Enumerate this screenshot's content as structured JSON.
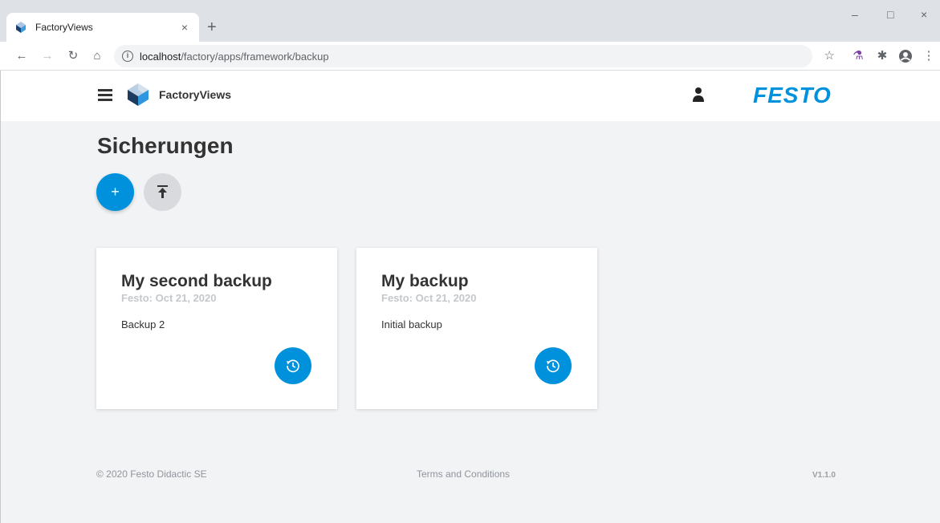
{
  "browser": {
    "tab_title": "FactoryViews",
    "tab_close": "×",
    "new_tab": "+",
    "url_host": "localhost",
    "url_path": "/factory/apps/framework/backup",
    "window_controls": [
      "–",
      "□",
      "×"
    ]
  },
  "header": {
    "app_name": "FactoryViews",
    "brand": "FESTO"
  },
  "main": {
    "title": "Sicherungen",
    "add_label": "+"
  },
  "cards": [
    {
      "title": "My second backup",
      "subtitle": "Festo: Oct 21, 2020",
      "description": "Backup 2"
    },
    {
      "title": "My backup",
      "subtitle": "Festo: Oct 21, 2020",
      "description": "Initial backup"
    }
  ],
  "footer": {
    "copyright": "© 2020 Festo Didactic SE",
    "terms": "Terms and Conditions",
    "version": "V1.1.0"
  },
  "colors": {
    "accent": "#0091dc",
    "background": "#f2f3f5"
  },
  "icons": [
    "hamburger-icon",
    "user-icon",
    "restore-icon",
    "upload-icon",
    "plus-icon"
  ]
}
